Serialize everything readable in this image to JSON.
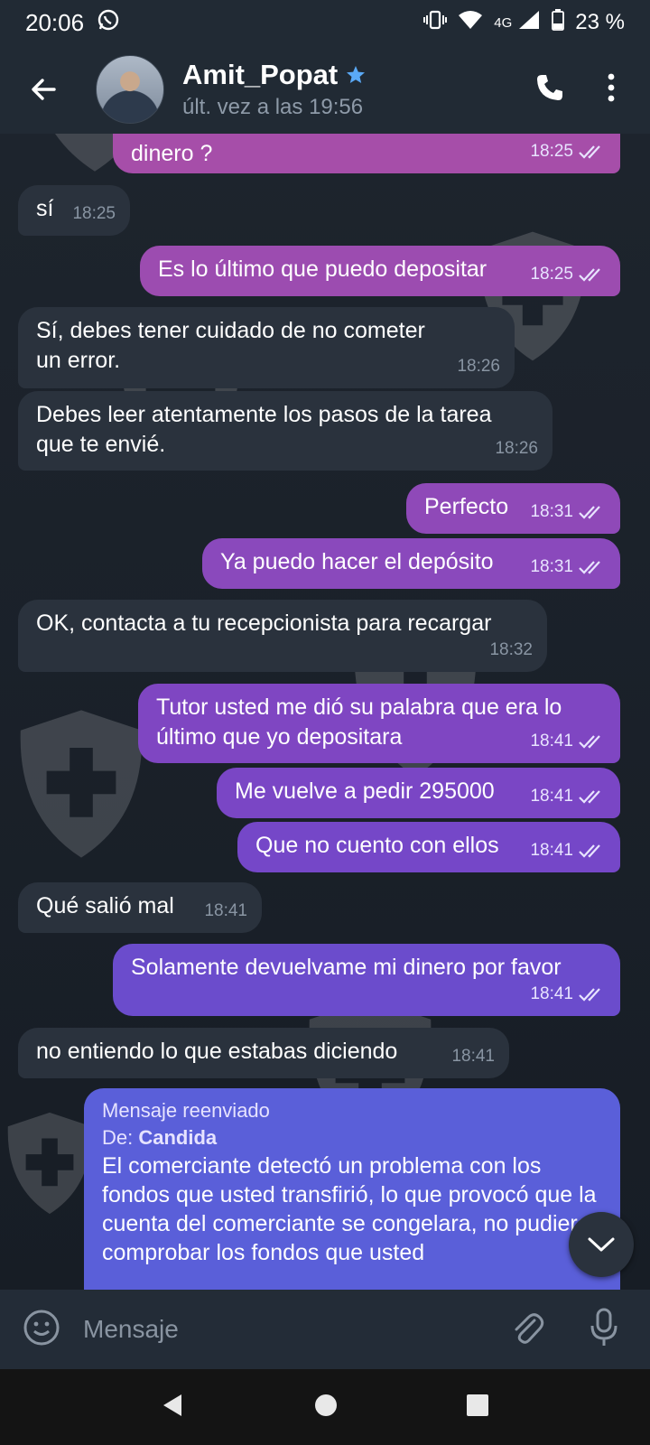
{
  "status_bar": {
    "time": "20:06",
    "network": "4G",
    "battery": "23 %"
  },
  "header": {
    "name": "Amit_Popat",
    "last_seen": "últ. vez a las 19:56"
  },
  "messages": [
    {
      "dir": "out",
      "text": "dinero ?",
      "time": "18:25"
    },
    {
      "dir": "in",
      "text": "sí",
      "time": "18:25"
    },
    {
      "dir": "out",
      "text": "Es lo último que puedo depositar",
      "time": "18:25"
    },
    {
      "dir": "in",
      "text": "Sí, debes tener cuidado de no cometer un error.",
      "time": "18:26"
    },
    {
      "dir": "in",
      "text": "Debes leer atentamente los pasos de la tarea que te envié.",
      "time": "18:26"
    },
    {
      "dir": "out",
      "text": "Perfecto",
      "time": "18:31"
    },
    {
      "dir": "out",
      "text": "Ya puedo hacer el depósito",
      "time": "18:31"
    },
    {
      "dir": "in",
      "text": "OK, contacta a tu recepcionista para recargar",
      "time": "18:32"
    },
    {
      "dir": "out",
      "text": "Tutor usted me dió su palabra que era lo último que yo depositara",
      "time": "18:41"
    },
    {
      "dir": "out",
      "text": "Me vuelve a pedir 295000",
      "time": "18:41"
    },
    {
      "dir": "out",
      "text": "Que no cuento con ellos",
      "time": "18:41"
    },
    {
      "dir": "in",
      "text": "Qué salió mal",
      "time": "18:41"
    },
    {
      "dir": "out",
      "text": "Solamente devuelvame mi dinero por favor",
      "time": "18:41"
    },
    {
      "dir": "in",
      "text": "no entiendo lo que estabas diciendo",
      "time": "18:41"
    }
  ],
  "forwarded": {
    "label": "Mensaje reenviado",
    "from_prefix": "De:",
    "from_name": "Candida",
    "text": "El comerciante detectó un problema con los fondos que usted transfirió, lo que provocó que la cuenta del comerciante se congelara, no pudiera comprobar los fondos que usted"
  },
  "composer": {
    "placeholder": "Mensaje"
  },
  "colors": {
    "out_top": "#a64ea9",
    "out_mid": "#7d44c7",
    "out_bottom": "#5a5fd9",
    "incoming": "#2a323d",
    "accent": "#5aa9f6"
  }
}
